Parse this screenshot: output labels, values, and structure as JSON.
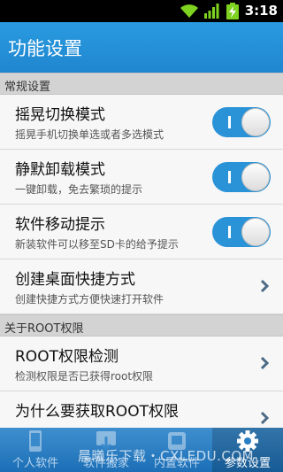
{
  "status_bar": {
    "time": "3:18"
  },
  "app_bar": {
    "title": "功能设置"
  },
  "sections": [
    {
      "label": "常规设置"
    },
    {
      "label": "关于ROOT权限"
    }
  ],
  "rows": [
    {
      "title": "摇晃切换模式",
      "subtitle": "摇晃手机切换单选或者多选模式",
      "toggle_on": true
    },
    {
      "title": "静默卸载模式",
      "subtitle": "一键卸载，免去繁琐的提示",
      "toggle_on": true
    },
    {
      "title": "软件移动提示",
      "subtitle": "新装软件可以移至SD卡的给予提示",
      "toggle_on": true
    },
    {
      "title": "创建桌面快捷方式",
      "subtitle": "创建快捷方式方便快速打开软件"
    },
    {
      "title": "ROOT权限检测",
      "subtitle": "检测权限是否已获得root权限"
    },
    {
      "title": "为什么要获取ROOT权限"
    }
  ],
  "tabs": [
    {
      "label": "个人软件"
    },
    {
      "label": "软件搬家"
    },
    {
      "label": "内置软件"
    },
    {
      "label": "参数设置",
      "active": true
    }
  ],
  "watermark": "晨曦乐下载・CXLEDU.COM",
  "colors": {
    "accent": "#2a93d8",
    "title_bar": "#2190d8",
    "tab_bar": "#2a7fc4"
  }
}
